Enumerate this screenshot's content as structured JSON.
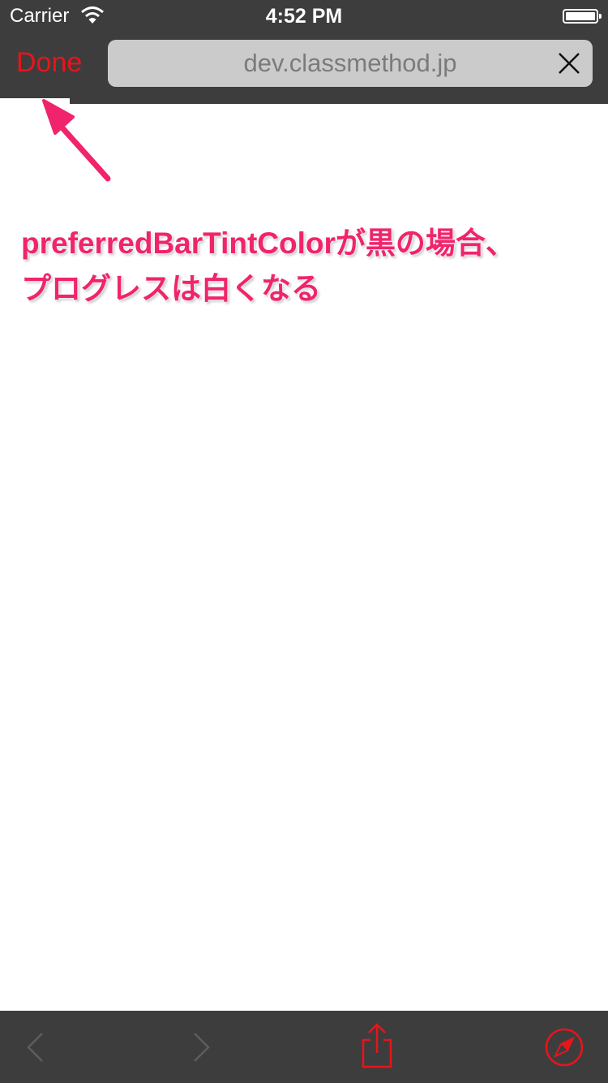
{
  "status_bar": {
    "carrier": "Carrier",
    "time": "4:52 PM"
  },
  "nav": {
    "done_label": "Done",
    "url": "dev.classmethod.jp",
    "clear_icon": "close-icon",
    "progress": 0.115
  },
  "annotation": {
    "line1": "preferredBarTintColorが黒の場合、",
    "line2": "プログレスは白くなる"
  },
  "toolbar": {
    "icons": [
      "back-icon",
      "forward-icon",
      "share-icon",
      "safari-compass-icon"
    ]
  },
  "colors": {
    "bar_background": "#3d3d3d",
    "tint": "#e8141c",
    "annotation": "#f0246c",
    "url_field": "#cbcbcb"
  }
}
